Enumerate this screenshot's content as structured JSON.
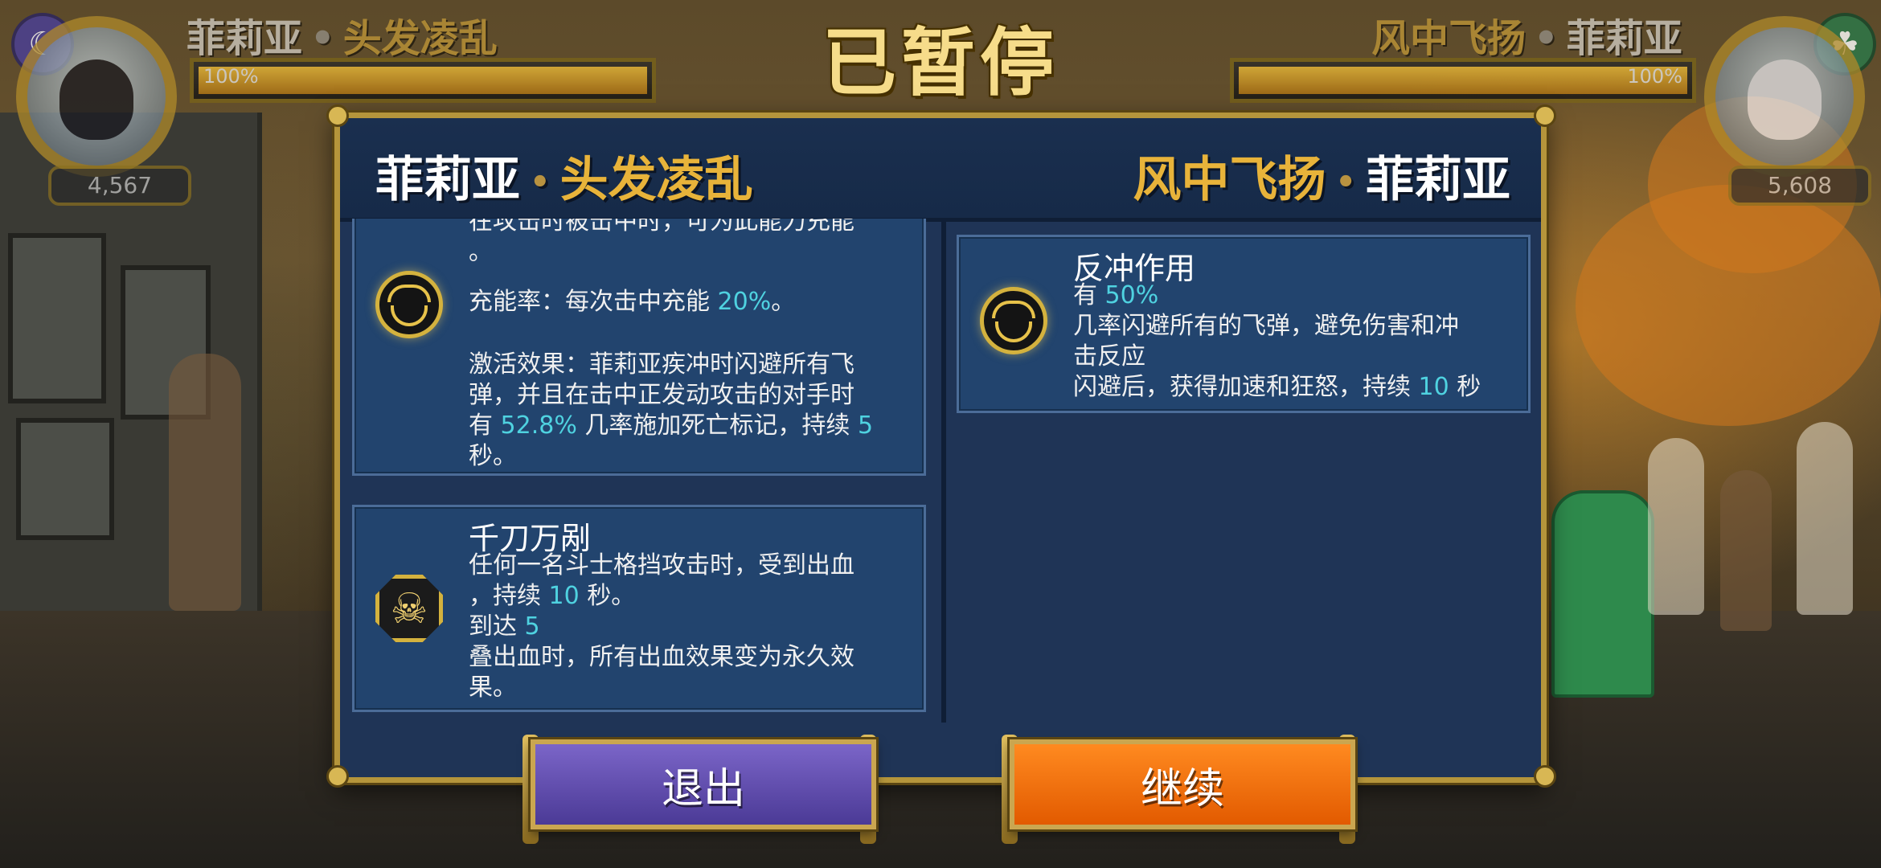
{
  "pause_title": "已暂停",
  "hud": {
    "left": {
      "name": "菲莉亚",
      "variant": "头发凌乱",
      "hp_percent": "100%",
      "score": "4,567"
    },
    "right": {
      "variant": "风中飞扬",
      "name": "菲莉亚",
      "hp_percent": "100%",
      "score": "5,608"
    }
  },
  "panel": {
    "header_left": {
      "name": "菲莉亚",
      "variant": "头发凌乱"
    },
    "header_right": {
      "variant": "风中飞扬",
      "name": "菲莉亚"
    },
    "left_card_1": {
      "top_line": "在攻击时被击中时，可为此能力充能",
      "top_line_end": "。",
      "charge_label": "充能率：每次击中充能",
      "charge_value": "20%",
      "charge_end": "。",
      "effect_line1": "激活效果：菲莉亚疾冲时闪避所有飞",
      "effect_line2": "弹，并且在击中正发动攻击的对手时",
      "effect_pre": "有",
      "effect_chance": "52.8%",
      "effect_mid": "几率施加死亡标记，持续",
      "effect_duration": "5",
      "effect_end": "秒。"
    },
    "left_card_2": {
      "title": "千刀万剐",
      "line1": "任何一名斗士格挡攻击时，受到出血",
      "line2_pre": "，持续",
      "line2_value": "10",
      "line2_end": "秒。",
      "line3_pre": "到达",
      "line3_value": "5",
      "line4": "叠出血时，所有出血效果变为永久效",
      "line5": "果。"
    },
    "right_card_1": {
      "title": "反冲作用",
      "line1_pre": "有",
      "line1_value": "50%",
      "line2": "几率闪避所有的飞弹，避免伤害和冲",
      "line3": "击反应",
      "line4_pre": "闪避后，获得加速和狂怒，持续",
      "line4_value": "10",
      "line4_end": "秒"
    }
  },
  "buttons": {
    "exit": "退出",
    "continue": "继续"
  },
  "colors": {
    "accent_cyan": "#4fd2e0",
    "gold": "#e8b33a",
    "exit_purple": "#5e4bb0",
    "continue_orange": "#f07010"
  },
  "icons": {
    "left_card_1": "grin-mask-icon",
    "left_card_2": "skull-icon",
    "right_card_1": "grin-mask-icon"
  }
}
